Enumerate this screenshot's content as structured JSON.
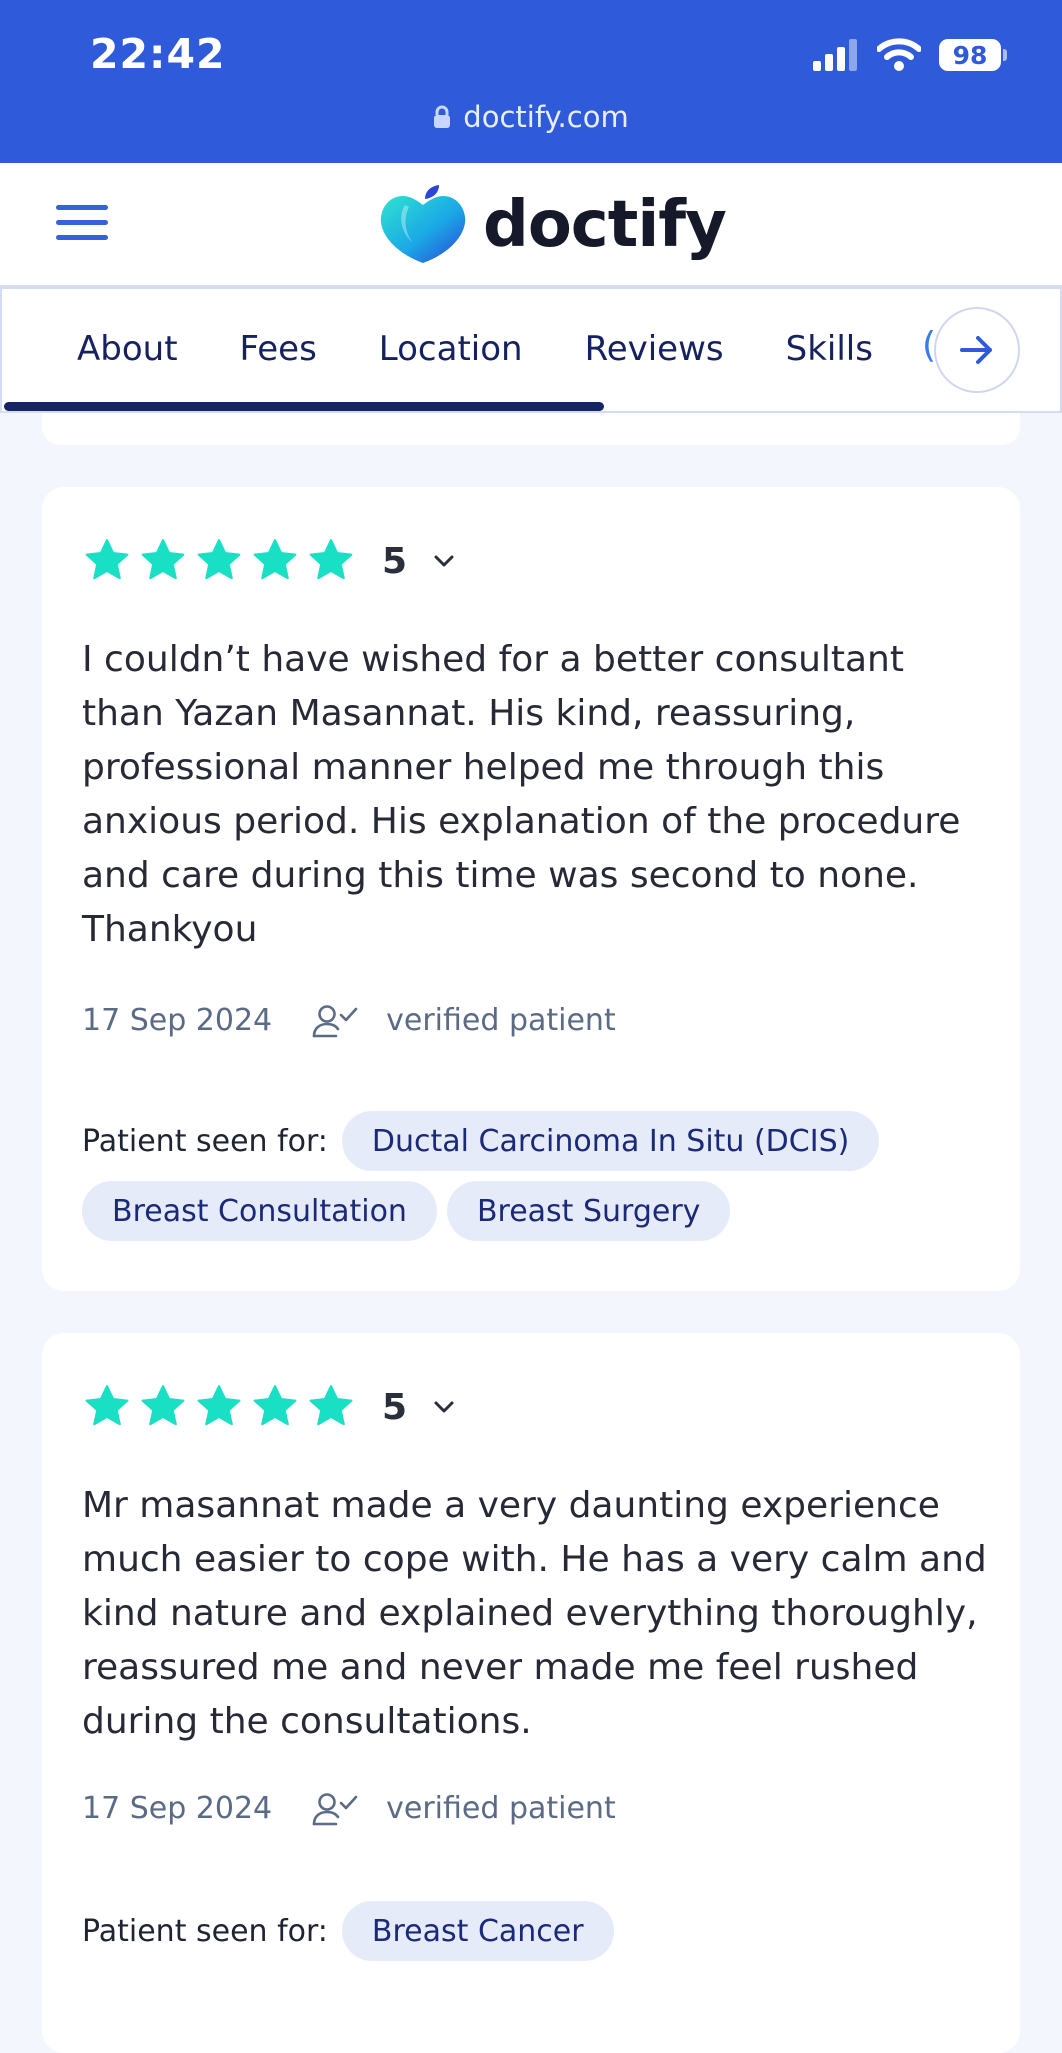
{
  "status_bar": {
    "time": "22:42",
    "battery": "98",
    "url": "doctify.com",
    "bg_color": "#2f5bdb"
  },
  "header": {
    "brand_name": "doctify",
    "menu_icon": "hamburger-icon",
    "logo_icon": "apple-heart-logo"
  },
  "tabs": {
    "items": [
      "About",
      "Fees",
      "Location",
      "Reviews",
      "Skills"
    ],
    "next_icon": "arrow-right-icon",
    "indicator_color": "#142466"
  },
  "reviews": [
    {
      "stars": 5,
      "rating": "5",
      "text": "I couldn’t have wished for a better consultant than Yazan Masannat. His kind, reassuring, professional manner helped me through this anxious period. His explanation of the procedure and care during this time was second to none. Thankyou",
      "date": "17 Sep 2024",
      "verified": "verified patient",
      "seen_for_label": "Patient seen for:",
      "conditions": [
        "Ductal Carcinoma In Situ (DCIS)",
        "Breast Consultation",
        "Breast Surgery"
      ]
    },
    {
      "stars": 5,
      "rating": "5",
      "text": "Mr masannat made a very daunting experience much easier to cope with. He has a very calm and kind nature and explained everything thoroughly, reassured me and never made me feel rushed during the consultations.",
      "date": "17 Sep 2024",
      "verified": "verified patient",
      "seen_for_label": "Patient seen for:",
      "conditions": [
        "Breast Cancer"
      ]
    }
  ],
  "colors": {
    "star": "#19e0c4",
    "chip_bg": "#e6ebfa",
    "chip_text": "#1b2a78"
  }
}
